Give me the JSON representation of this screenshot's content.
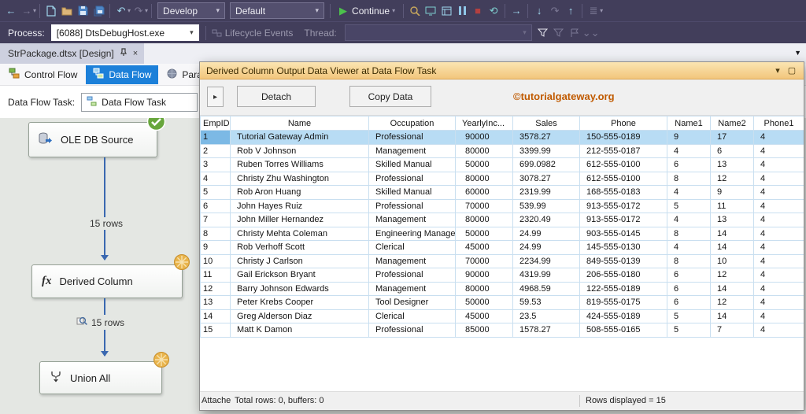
{
  "icons": {
    "back": "←",
    "forward": "→",
    "undo": "↶",
    "redo": "↷",
    "dropdown": "▾",
    "play": "▶",
    "stop": "■",
    "restart": "⟲",
    "step_next": "→",
    "step_into": "↓",
    "step_over": "↷",
    "step_out": "↑",
    "watch": "≣",
    "overflow": "⌄⌄",
    "close": "×",
    "maximize": "▢",
    "tab_menu": "▼",
    "expand": "▸",
    "fx": "fx"
  },
  "toolbar": {
    "develop_label": "Develop",
    "default_label": "Default",
    "continue_label": "Continue"
  },
  "debug_bar": {
    "process_label": "Process:",
    "process_value": "[6088] DtsDebugHost.exe",
    "lifecycle_events_label": "Lifecycle Events",
    "thread_label": "Thread:"
  },
  "document_tab": {
    "title": "StrPackage.dtsx [Design]"
  },
  "designer_tabs": {
    "control_flow": "Control Flow",
    "data_flow": "Data Flow",
    "parameters": "Parameters"
  },
  "task_selector": {
    "label": "Data Flow Task:",
    "value": "Data Flow Task"
  },
  "canvas": {
    "source_label": "OLE DB Source",
    "derived_label": "Derived Column",
    "union_label": "Union All",
    "rows_label_top": "15 rows",
    "rows_label_bottom": "15 rows"
  },
  "data_viewer": {
    "title": "Derived Column Output Data Viewer at Data Flow Task",
    "detach_label": "Detach",
    "copy_data_label": "Copy Data",
    "watermark": "©tutorialgateway.org",
    "grid": {
      "columns": [
        "EmpID",
        "Name",
        "Occupation",
        "YearlyInc...",
        "Sales",
        "Phone",
        "Name1",
        "Name2",
        "Phone1"
      ],
      "selected_row_index": 0,
      "rows": [
        [
          "1",
          "Tutorial Gateway Admin",
          "Professional",
          "90000",
          "3578.27",
          "150-555-0189",
          "9",
          "17",
          "4"
        ],
        [
          "2",
          "Rob V Johnson",
          "Management",
          "80000",
          "3399.99",
          "212-555-0187",
          "4",
          "6",
          "4"
        ],
        [
          "3",
          "Ruben Torres Williams",
          "Skilled Manual",
          "50000",
          "699.0982",
          "612-555-0100",
          "6",
          "13",
          "4"
        ],
        [
          "4",
          "Christy Zhu Washington",
          "Professional",
          "80000",
          "3078.27",
          "612-555-0100",
          "8",
          "12",
          "4"
        ],
        [
          "5",
          "Rob Aron Huang",
          "Skilled Manual",
          "60000",
          "2319.99",
          "168-555-0183",
          "4",
          "9",
          "4"
        ],
        [
          "6",
          "John Hayes Ruiz",
          "Professional",
          "70000",
          "539.99",
          "913-555-0172",
          "5",
          "11",
          "4"
        ],
        [
          "7",
          "John Miller Hernandez",
          "Management",
          "80000",
          "2320.49",
          "913-555-0172",
          "4",
          "13",
          "4"
        ],
        [
          "8",
          "Christy Mehta Coleman",
          "Engineering Manager",
          "50000",
          "24.99",
          "903-555-0145",
          "8",
          "14",
          "4"
        ],
        [
          "9",
          "Rob Verhoff Scott",
          "Clerical",
          "45000",
          "24.99",
          "145-555-0130",
          "4",
          "14",
          "4"
        ],
        [
          "10",
          "Christy J Carlson",
          "Management",
          "70000",
          "2234.99",
          "849-555-0139",
          "8",
          "10",
          "4"
        ],
        [
          "11",
          "Gail Erickson Bryant",
          "Professional",
          "90000",
          "4319.99",
          "206-555-0180",
          "6",
          "12",
          "4"
        ],
        [
          "12",
          "Barry Johnson Edwards",
          "Management",
          "80000",
          "4968.59",
          "122-555-0189",
          "6",
          "14",
          "4"
        ],
        [
          "13",
          "Peter Krebs Cooper",
          "Tool Designer",
          "50000",
          "59.53",
          "819-555-0175",
          "6",
          "12",
          "4"
        ],
        [
          "14",
          "Greg Alderson Diaz",
          "Clerical",
          "45000",
          "23.5",
          "424-555-0189",
          "5",
          "14",
          "4"
        ],
        [
          "15",
          "Matt K Damon",
          "Professional",
          "85000",
          "1578.27",
          "508-555-0165",
          "5",
          "7",
          "4"
        ]
      ]
    },
    "status": {
      "attach_label": "Attache",
      "totals_label": "Total rows: 0, buffers: 0",
      "rows_displayed_label": "Rows displayed = 15"
    }
  },
  "colors": {
    "toolbar_dark": "#423E5B",
    "titlebar_orange": "#F2C67C",
    "selected_row_blue": "#B8DCF4",
    "selected_cell_blue": "#7CB9E5",
    "accent_blue": "#1C80D9"
  }
}
